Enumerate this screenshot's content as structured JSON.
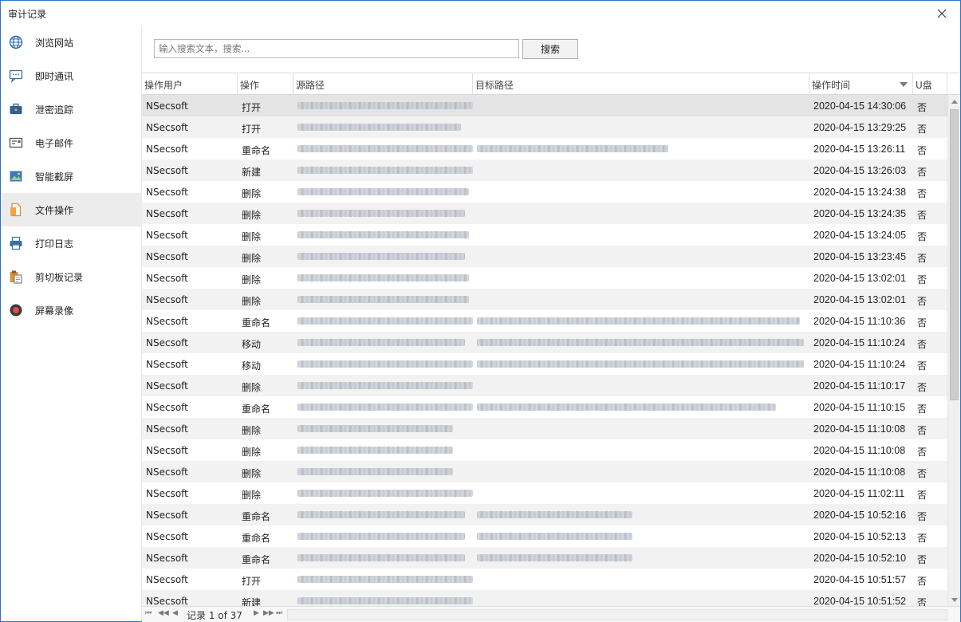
{
  "window": {
    "title": "审计记录",
    "close_label": "✕"
  },
  "sidebar": {
    "items": [
      {
        "label": "浏览网站",
        "icon": "globe-icon"
      },
      {
        "label": "即时通讯",
        "icon": "chat-icon"
      },
      {
        "label": "泄密追踪",
        "icon": "briefcase-icon"
      },
      {
        "label": "电子邮件",
        "icon": "email-icon"
      },
      {
        "label": "智能截屏",
        "icon": "screenshot-icon"
      },
      {
        "label": "文件操作",
        "icon": "file-icon",
        "active": true
      },
      {
        "label": "打印日志",
        "icon": "printer-icon"
      },
      {
        "label": "剪切板记录",
        "icon": "clipboard-icon"
      },
      {
        "label": "屏幕录像",
        "icon": "record-icon"
      }
    ]
  },
  "search": {
    "placeholder": "输入搜索文本，搜索...",
    "button_label": "搜索"
  },
  "grid": {
    "columns": [
      "操作用户",
      "操作",
      "源路径",
      "目标路径",
      "操作时间",
      "U盘"
    ],
    "rows": [
      {
        "user": "NSecsoft",
        "op": "打开",
        "time": "2020-04-15 14:30:06",
        "u": "否",
        "src_w": 220,
        "dst_w": 0
      },
      {
        "user": "NSecsoft",
        "op": "打开",
        "time": "2020-04-15 13:29:25",
        "u": "否",
        "src_w": 205,
        "dst_w": 0
      },
      {
        "user": "NSecsoft",
        "op": "重命名",
        "time": "2020-04-15 13:26:11",
        "u": "否",
        "src_w": 220,
        "dst_w": 240
      },
      {
        "user": "NSecsoft",
        "op": "新建",
        "time": "2020-04-15 13:26:03",
        "u": "否",
        "src_w": 220,
        "dst_w": 0
      },
      {
        "user": "NSecsoft",
        "op": "删除",
        "time": "2020-04-15 13:24:38",
        "u": "否",
        "src_w": 215,
        "dst_w": 0
      },
      {
        "user": "NSecsoft",
        "op": "删除",
        "time": "2020-04-15 13:24:35",
        "u": "否",
        "src_w": 210,
        "dst_w": 0
      },
      {
        "user": "NSecsoft",
        "op": "删除",
        "time": "2020-04-15 13:24:05",
        "u": "否",
        "src_w": 215,
        "dst_w": 0
      },
      {
        "user": "NSecsoft",
        "op": "删除",
        "time": "2020-04-15 13:23:45",
        "u": "否",
        "src_w": 210,
        "dst_w": 0
      },
      {
        "user": "NSecsoft",
        "op": "删除",
        "time": "2020-04-15 13:02:01",
        "u": "否",
        "src_w": 215,
        "dst_w": 0
      },
      {
        "user": "NSecsoft",
        "op": "删除",
        "time": "2020-04-15 13:02:01",
        "u": "否",
        "src_w": 215,
        "dst_w": 0
      },
      {
        "user": "NSecsoft",
        "op": "重命名",
        "time": "2020-04-15 11:10:36",
        "u": "否",
        "src_w": 220,
        "dst_w": 405
      },
      {
        "user": "NSecsoft",
        "op": "移动",
        "time": "2020-04-15 11:10:24",
        "u": "否",
        "src_w": 210,
        "dst_w": 410
      },
      {
        "user": "NSecsoft",
        "op": "移动",
        "time": "2020-04-15 11:10:24",
        "u": "否",
        "src_w": 220,
        "dst_w": 410
      },
      {
        "user": "NSecsoft",
        "op": "删除",
        "time": "2020-04-15 11:10:17",
        "u": "否",
        "src_w": 220,
        "dst_w": 0
      },
      {
        "user": "NSecsoft",
        "op": "重命名",
        "time": "2020-04-15 11:10:15",
        "u": "否",
        "src_w": 220,
        "dst_w": 375
      },
      {
        "user": "NSecsoft",
        "op": "删除",
        "time": "2020-04-15 11:10:08",
        "u": "否",
        "src_w": 195,
        "dst_w": 0
      },
      {
        "user": "NSecsoft",
        "op": "删除",
        "time": "2020-04-15 11:10:08",
        "u": "否",
        "src_w": 195,
        "dst_w": 0
      },
      {
        "user": "NSecsoft",
        "op": "删除",
        "time": "2020-04-15 11:10:08",
        "u": "否",
        "src_w": 195,
        "dst_w": 0
      },
      {
        "user": "NSecsoft",
        "op": "删除",
        "time": "2020-04-15 11:02:11",
        "u": "否",
        "src_w": 220,
        "dst_w": 0
      },
      {
        "user": "NSecsoft",
        "op": "重命名",
        "time": "2020-04-15 10:52:16",
        "u": "否",
        "src_w": 210,
        "dst_w": 195
      },
      {
        "user": "NSecsoft",
        "op": "重命名",
        "time": "2020-04-15 10:52:13",
        "u": "否",
        "src_w": 210,
        "dst_w": 195
      },
      {
        "user": "NSecsoft",
        "op": "重命名",
        "time": "2020-04-15 10:52:10",
        "u": "否",
        "src_w": 210,
        "dst_w": 195
      },
      {
        "user": "NSecsoft",
        "op": "打开",
        "time": "2020-04-15 10:51:57",
        "u": "否",
        "src_w": 220,
        "dst_w": 0
      },
      {
        "user": "NSecsoft",
        "op": "新建",
        "time": "2020-04-15 10:51:52",
        "u": "否",
        "src_w": 220,
        "dst_w": 0
      }
    ]
  },
  "pager": {
    "text": "记录 1 of 37"
  }
}
